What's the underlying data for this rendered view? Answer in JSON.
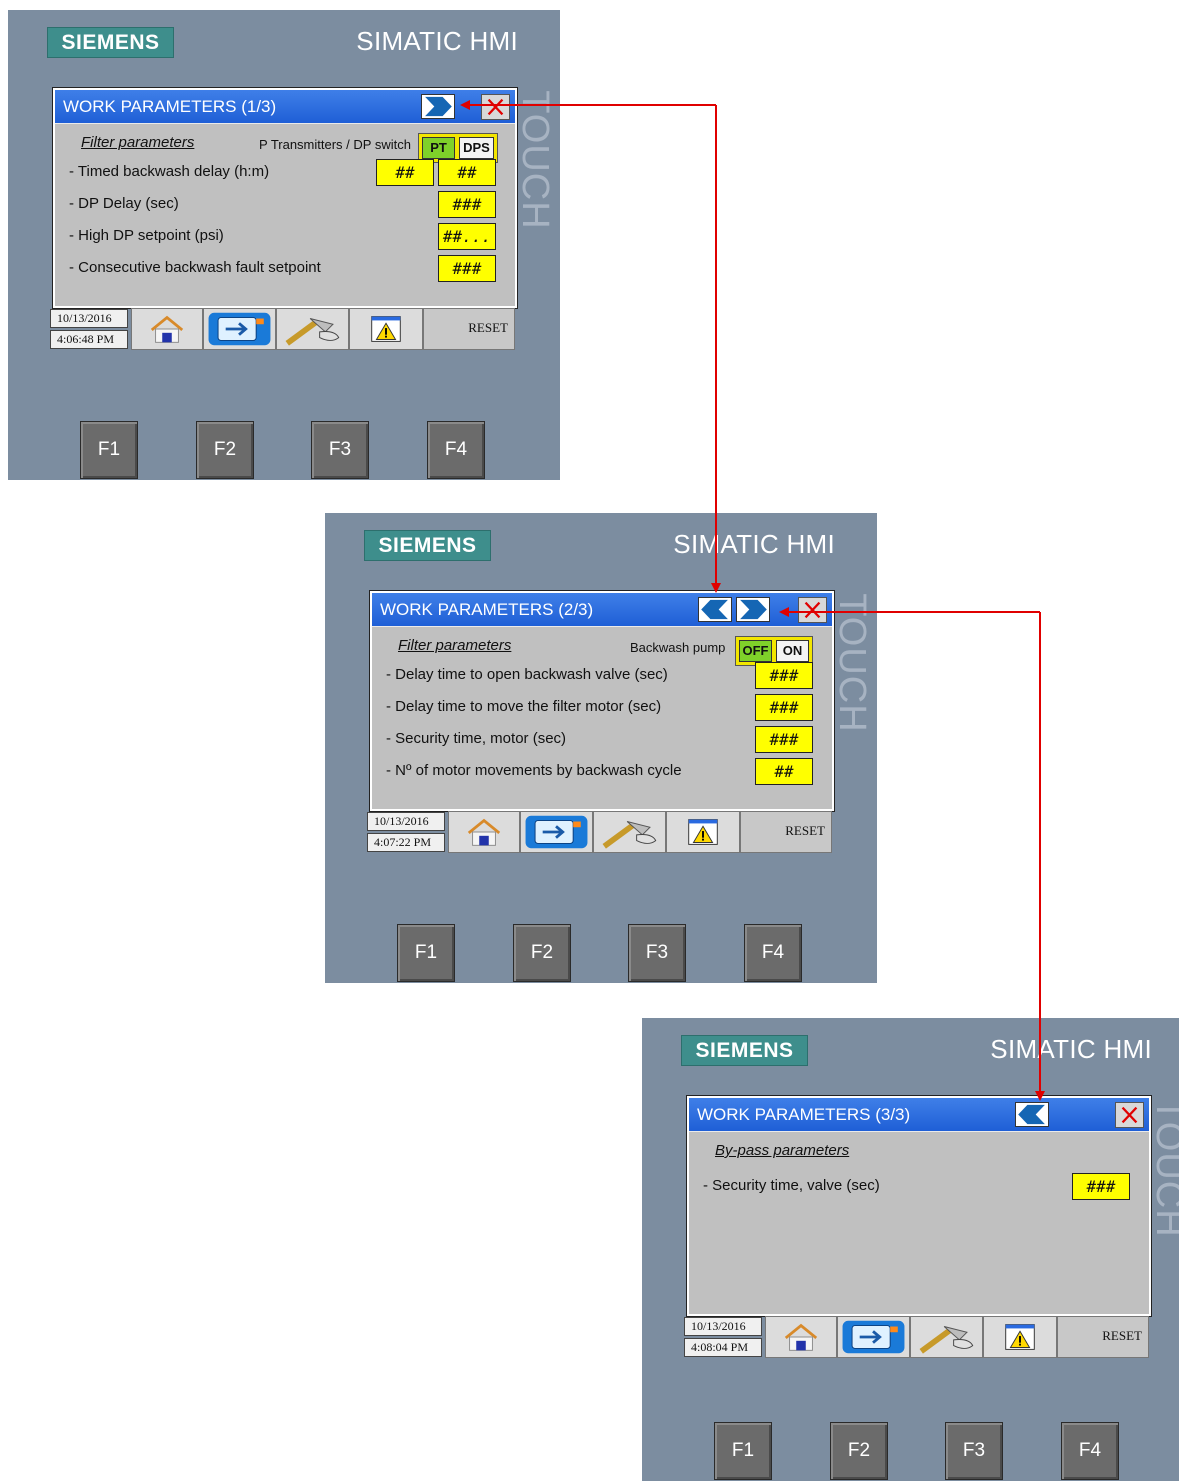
{
  "panels": [
    {
      "brand": "SIEMENS",
      "product": "SIMATIC HMI",
      "touch": "TOUCH",
      "title": "WORK PARAMETERS (1/3)",
      "section": "Filter parameters",
      "toggle": {
        "label": "P Transmitters / DP switch",
        "options": [
          "PT",
          "DPS"
        ],
        "active": "PT"
      },
      "rows": [
        {
          "label": "- Timed backwash delay (h:m)",
          "values": [
            "##",
            "##"
          ]
        },
        {
          "label": "- DP Delay (sec)",
          "values": [
            "###"
          ]
        },
        {
          "label": "- High DP setpoint (psi)",
          "values": [
            "##..."
          ]
        },
        {
          "label": "- Consecutive backwash fault setpoint",
          "values": [
            "###"
          ]
        }
      ],
      "date": "10/13/2016",
      "time": "4:06:48 PM",
      "reset": "RESET",
      "fkeys": [
        "F1",
        "F2",
        "F3",
        "F4"
      ]
    },
    {
      "brand": "SIEMENS",
      "product": "SIMATIC HMI",
      "touch": "TOUCH",
      "title": "WORK PARAMETERS (2/3)",
      "section": "Filter parameters",
      "toggle": {
        "label": "Backwash pump",
        "options": [
          "OFF",
          "ON"
        ],
        "active": "OFF"
      },
      "rows": [
        {
          "label": "- Delay time to open backwash valve (sec)",
          "values": [
            "###"
          ]
        },
        {
          "label": "- Delay time to move the filter motor (sec)",
          "values": [
            "###"
          ]
        },
        {
          "label": "- Security time, motor (sec)",
          "values": [
            "###"
          ]
        },
        {
          "label": "- Nº of motor movements by backwash cycle",
          "values": [
            "##"
          ]
        }
      ],
      "date": "10/13/2016",
      "time": "4:07:22 PM",
      "reset": "RESET",
      "fkeys": [
        "F1",
        "F2",
        "F3",
        "F4"
      ]
    },
    {
      "brand": "SIEMENS",
      "product": "SIMATIC HMI",
      "touch": "TOUCH",
      "title": "WORK PARAMETERS (3/3)",
      "section": "By-pass parameters",
      "rows": [
        {
          "label": "- Security time, valve (sec)",
          "values": [
            "###"
          ]
        }
      ],
      "date": "10/13/2016",
      "time": "4:08:04 PM",
      "reset": "RESET",
      "fkeys": [
        "F1",
        "F2",
        "F3",
        "F4"
      ]
    }
  ],
  "colors": {
    "bezel": "#7c8da0",
    "titlebar": "#2a6ae0",
    "field": "#ffff00",
    "toggle_active": "#7fd12a",
    "arrow": "#e00000"
  },
  "icons": [
    "next-page-icon",
    "previous-page-icon",
    "close-icon",
    "home-icon",
    "screen-switch-icon",
    "tools-icon",
    "alarm-warning-icon"
  ]
}
